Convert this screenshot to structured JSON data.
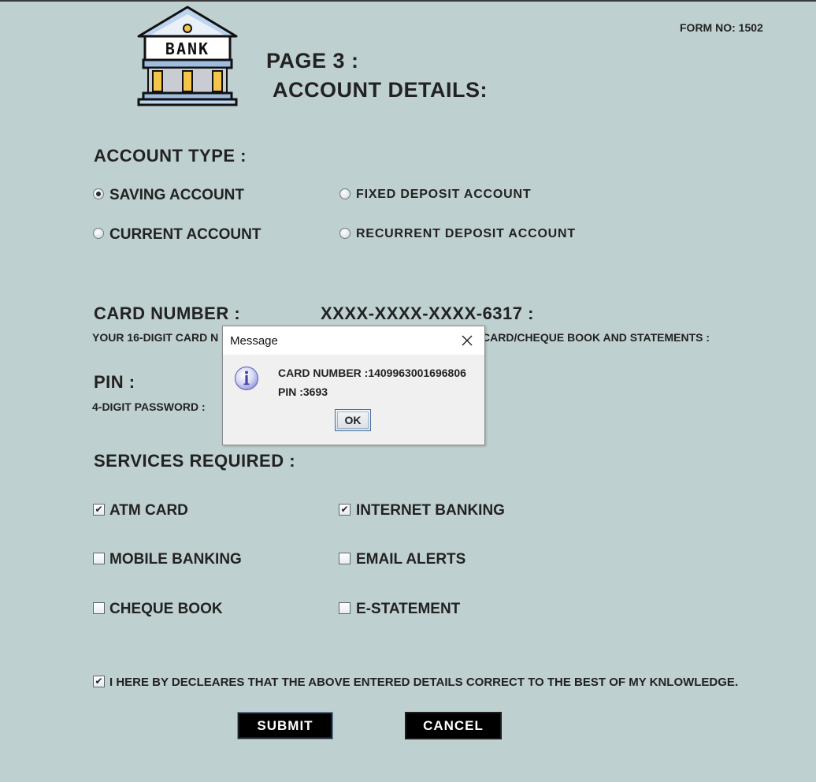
{
  "header": {
    "form_no": "FORM NO: 1502",
    "page_title": "PAGE 3 :",
    "page_subtitle": "ACCOUNT DETAILS:",
    "logo_text": "BANK"
  },
  "account_type": {
    "heading": "ACCOUNT TYPE :",
    "options": [
      {
        "label": "SAVING ACCOUNT",
        "checked": true
      },
      {
        "label": "FIXED DEPOSIT ACCOUNT",
        "checked": false
      },
      {
        "label": "CURRENT ACCOUNT",
        "checked": false
      },
      {
        "label": "RECURRENT DEPOSIT ACCOUNT",
        "checked": false
      }
    ]
  },
  "card": {
    "label": "CARD NUMBER :",
    "value": "XXXX-XXXX-XXXX-6317 :",
    "hint_left": "YOUR 16-DIGIT CARD N",
    "hint_right": "CARD/CHEQUE BOOK AND STATEMENTS  :"
  },
  "pin": {
    "label": "PIN  :",
    "hint": "4-DIGIT PASSWORD :"
  },
  "services": {
    "heading": "SERVICES REQUIRED :",
    "items": [
      {
        "label": "ATM CARD",
        "checked": true
      },
      {
        "label": "INTERNET BANKING",
        "checked": true
      },
      {
        "label": "MOBILE BANKING",
        "checked": false
      },
      {
        "label": "EMAIL ALERTS",
        "checked": false
      },
      {
        "label": "CHEQUE BOOK",
        "checked": false
      },
      {
        "label": "E-STATEMENT",
        "checked": false
      }
    ]
  },
  "declaration": {
    "label": "I HERE BY DECLEARES THAT THE ABOVE ENTERED DETAILS CORRECT TO THE BEST OF MY KNLOWLEDGE.",
    "checked": true
  },
  "buttons": {
    "submit": "SUBMIT",
    "cancel": "CANCEL"
  },
  "dialog": {
    "title": "Message",
    "line1": "CARD NUMBER :1409963001696806",
    "line2": "PIN :3693",
    "ok": "OK"
  },
  "icons": [
    "bank-logo-icon",
    "info-icon",
    "close-icon"
  ],
  "colors": {
    "background": "#bfd0d0",
    "button_bg": "#000000",
    "button_text": "#ffffff",
    "dialog_bg": "#f0f0f0"
  }
}
